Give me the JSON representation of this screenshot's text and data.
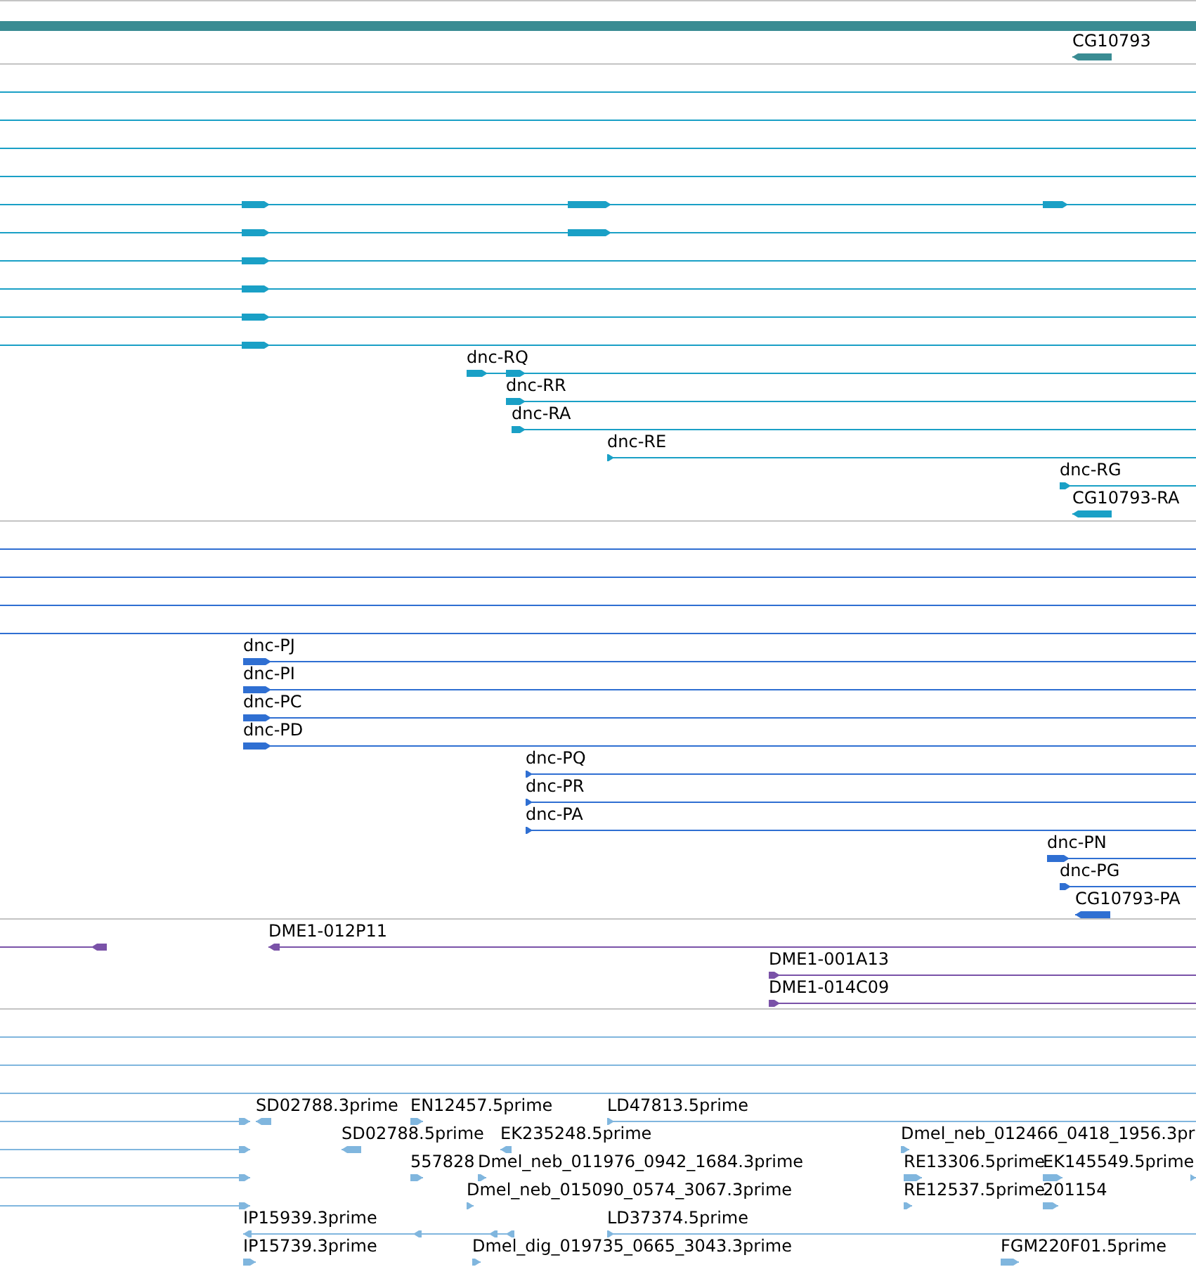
{
  "tracks": [
    {
      "color": "#3a8c93",
      "rows": [
        {
          "kind": "glyphs",
          "features": [
            {
              "reverse": true
            }
          ]
        },
        {
          "kind": "glyphs",
          "features": [
            {
              "label": "CG10793",
              "reverse": true
            }
          ]
        }
      ]
    },
    {
      "color": "#1aa0c6",
      "rows": [
        {
          "kind": "line"
        },
        {
          "kind": "line"
        },
        {
          "kind": "line"
        },
        {
          "kind": "line"
        },
        {
          "kind": "glyphs",
          "features": [
            {
              "reverse": false
            }
          ]
        },
        {
          "kind": "glyphs",
          "features": [
            {
              "reverse": false
            }
          ]
        },
        {
          "kind": "glyphs",
          "features": [
            {
              "reverse": false
            }
          ]
        },
        {
          "kind": "glyphs",
          "features": [
            {
              "reverse": false
            }
          ]
        },
        {
          "kind": "glyphs",
          "features": [
            {
              "reverse": false
            }
          ]
        },
        {
          "kind": "glyphs",
          "features": [
            {
              "reverse": false
            }
          ]
        },
        {
          "kind": "glyphs",
          "features": [
            {
              "label": "dnc-RQ",
              "reverse": false
            }
          ]
        },
        {
          "kind": "glyphs",
          "features": [
            {
              "label": "dnc-RR",
              "reverse": false
            }
          ]
        },
        {
          "kind": "glyphs",
          "features": [
            {
              "label": "dnc-RA",
              "reverse": false
            }
          ]
        },
        {
          "kind": "glyphs",
          "features": [
            {
              "label": "dnc-RE",
              "reverse": false
            }
          ]
        },
        {
          "kind": "glyphs",
          "features": [
            {
              "label": "dnc-RG",
              "reverse": false
            }
          ]
        },
        {
          "kind": "glyphs",
          "features": [
            {
              "label": "CG10793-RA",
              "reverse": true
            }
          ]
        }
      ]
    },
    {
      "color": "#2f6fd2",
      "rows": [
        {
          "kind": "line"
        },
        {
          "kind": "line"
        },
        {
          "kind": "line"
        },
        {
          "kind": "line"
        },
        {
          "kind": "glyphs",
          "features": [
            {
              "label": "dnc-PJ",
              "reverse": false
            }
          ]
        },
        {
          "kind": "glyphs",
          "features": [
            {
              "label": "dnc-PI",
              "reverse": false
            }
          ]
        },
        {
          "kind": "glyphs",
          "features": [
            {
              "label": "dnc-PC",
              "reverse": false
            }
          ]
        },
        {
          "kind": "glyphs",
          "features": [
            {
              "label": "dnc-PD",
              "reverse": false
            }
          ]
        },
        {
          "kind": "glyphs",
          "features": [
            {
              "label": "dnc-PQ",
              "reverse": false
            }
          ]
        },
        {
          "kind": "glyphs",
          "features": [
            {
              "label": "dnc-PR",
              "reverse": false
            }
          ]
        },
        {
          "kind": "glyphs",
          "features": [
            {
              "label": "dnc-PA",
              "reverse": false
            }
          ]
        },
        {
          "kind": "glyphs",
          "features": [
            {
              "label": "dnc-PN",
              "reverse": false
            }
          ]
        },
        {
          "kind": "glyphs",
          "features": [
            {
              "label": "dnc-PG",
              "reverse": false
            }
          ]
        },
        {
          "kind": "glyphs",
          "features": [
            {
              "label": "CG10793-PA",
              "reverse": true
            }
          ]
        }
      ]
    },
    {
      "color": "#7a52a8",
      "rows": [
        {
          "kind": "glyphs",
          "features": [
            {
              "reverse": true
            },
            {
              "label": "DME1-012P11",
              "reverse": true
            }
          ]
        },
        {
          "kind": "glyphs",
          "features": [
            {
              "label": "DME1-001A13",
              "reverse": false
            }
          ]
        },
        {
          "kind": "glyphs",
          "features": [
            {
              "label": "DME1-014C09",
              "reverse": false
            }
          ]
        }
      ]
    },
    {
      "color": "#80b6de",
      "rows": [
        {
          "kind": "line"
        },
        {
          "kind": "line"
        },
        {
          "kind": "line"
        },
        {
          "kind": "glyphs",
          "features": [
            {
              "reverse": false
            },
            {
              "label": "SD02788.3prime",
              "reverse": true
            },
            {
              "label": "EN12457.5prime",
              "reverse": false
            },
            {
              "label": "LD47813.5prime",
              "reverse": false
            }
          ]
        },
        {
          "kind": "glyphs",
          "features": [
            {
              "reverse": false
            },
            {
              "label": "SD02788.5prime",
              "reverse": true
            },
            {
              "label": "EK235248.5prime",
              "reverse": true
            },
            {
              "label": "Dmel_neb_012466_0418_1956.3pr",
              "reverse": false
            }
          ]
        },
        {
          "kind": "glyphs",
          "features": [
            {
              "reverse": false
            },
            {
              "label": "557828",
              "reverse": false
            },
            {
              "label": "Dmel_neb_011976_0942_1684.3prime",
              "reverse": false
            },
            {
              "label": "RE13306.5prime",
              "reverse": false
            },
            {
              "label": "EK145549.5prime",
              "reverse": false
            },
            {
              "reverse": false
            }
          ]
        },
        {
          "kind": "glyphs",
          "features": [
            {
              "reverse": false
            },
            {
              "label": "Dmel_neb_015090_0574_3067.3prime",
              "reverse": false
            },
            {
              "label": "RE12537.5prime",
              "reverse": false
            },
            {
              "label": "201154",
              "reverse": false
            }
          ]
        },
        {
          "kind": "glyphs",
          "features": [
            {
              "label": "IP15939.3prime",
              "reverse": true
            },
            {
              "label": "LD37374.5prime",
              "reverse": false
            }
          ]
        },
        {
          "kind": "glyphs",
          "features": [
            {
              "label": "IP15739.3prime",
              "reverse": false
            },
            {
              "label": "Dmel_dig_019735_0665_3043.3prime",
              "reverse": false
            },
            {
              "label": "FGM220F01.5prime",
              "reverse": false
            }
          ]
        }
      ]
    }
  ]
}
